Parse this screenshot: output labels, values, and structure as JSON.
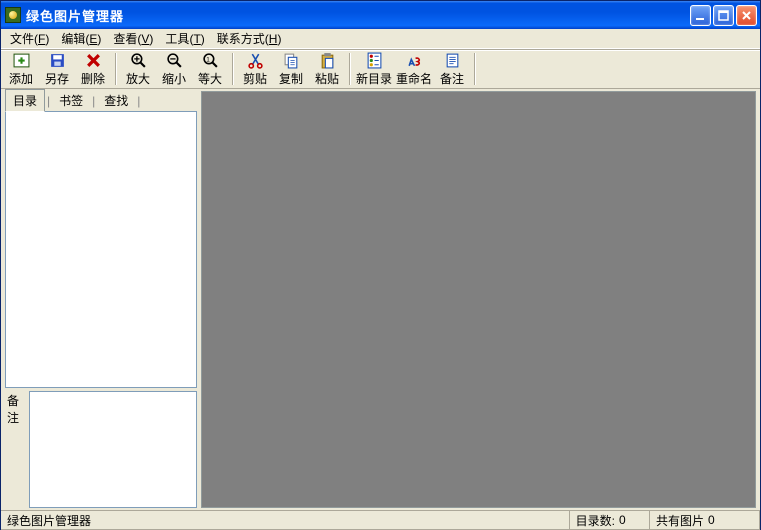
{
  "window": {
    "title": "绿色图片管理器"
  },
  "menu": {
    "file": {
      "label": "文件",
      "accel": "F"
    },
    "edit": {
      "label": "编辑",
      "accel": "E"
    },
    "view": {
      "label": "查看",
      "accel": "V"
    },
    "tools": {
      "label": "工具",
      "accel": "T"
    },
    "contact": {
      "label": "联系方式",
      "accel": "H"
    }
  },
  "toolbar": {
    "add": "添加",
    "saveas": "另存",
    "delete": "删除",
    "zoomin": "放大",
    "zoomout": "缩小",
    "zoomfit": "等大",
    "cut": "剪贴",
    "copy": "复制",
    "paste": "粘贴",
    "newdir": "新目录",
    "rename": "重命名",
    "notes": "备注"
  },
  "sidebar": {
    "tabs": {
      "catalog": "目录",
      "bookmarks": "书签",
      "search": "查找"
    },
    "notes_label": "备注"
  },
  "status": {
    "app": "绿色图片管理器",
    "dir_label": "目录数:",
    "dir_count": "0",
    "images_label": "共有图片",
    "images_count": "0"
  }
}
